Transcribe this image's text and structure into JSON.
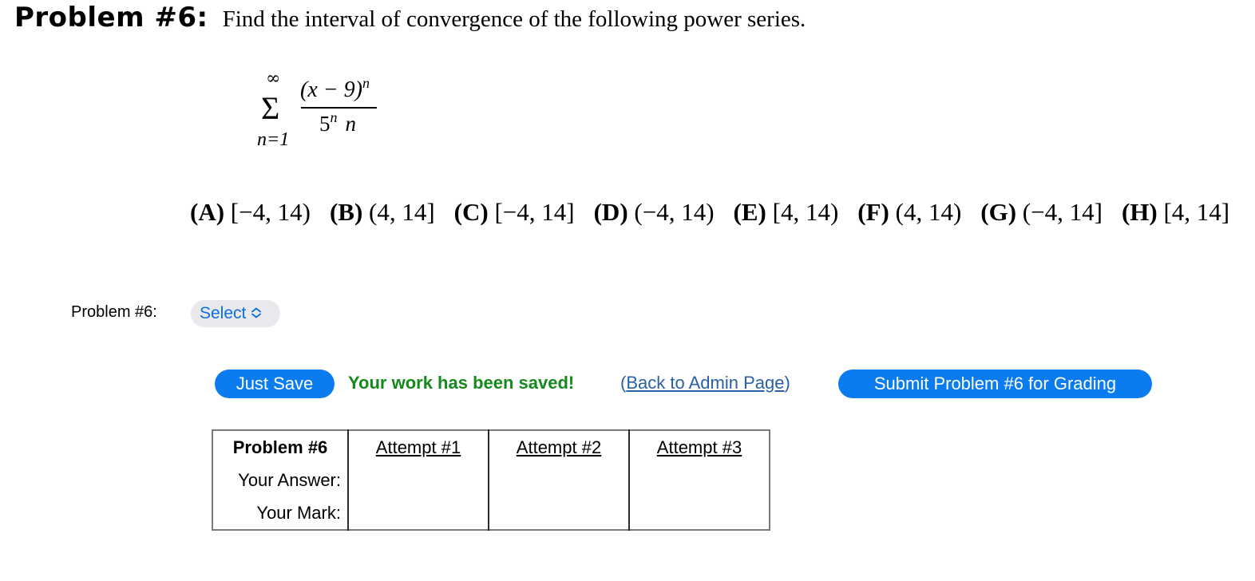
{
  "header": {
    "title": "Problem #6:",
    "instruction": "Find the interval of convergence of the following power series."
  },
  "formula": {
    "sum_upper": "∞",
    "sum_symbol": "Σ",
    "sum_lower": "n=1",
    "numerator_base": "(x − 9)",
    "numerator_exp": "n",
    "denominator_base": "5",
    "denominator_exp": "n",
    "denominator_tail": "n"
  },
  "choices": [
    {
      "letter": "(A)",
      "interval": "[−4, 14)"
    },
    {
      "letter": "(B)",
      "interval": "(4, 14]"
    },
    {
      "letter": "(C)",
      "interval": "[−4, 14]"
    },
    {
      "letter": "(D)",
      "interval": "(−4, 14)"
    },
    {
      "letter": "(E)",
      "interval": "[4, 14)"
    },
    {
      "letter": "(F)",
      "interval": "(4, 14)"
    },
    {
      "letter": "(G)",
      "interval": "(−4, 14]"
    },
    {
      "letter": "(H)",
      "interval": "[4, 14]"
    }
  ],
  "answer": {
    "label": "Problem #6:",
    "select_value": "Select",
    "chevron_icon": "up-down-chevron-icon"
  },
  "actions": {
    "save_label": "Just Save",
    "saved_message": "Your work has been saved!",
    "admin_link_open": "(",
    "admin_link_text": "Back to Admin Page",
    "admin_link_close": ")",
    "submit_label": "Submit Problem #6 for Grading"
  },
  "attempts_table": {
    "header_label": "Problem #6",
    "attempts": [
      "Attempt #1",
      "Attempt #2",
      "Attempt #3"
    ],
    "row_answer_label": "Your Answer:",
    "row_mark_label": "Your Mark:",
    "answers": [
      "",
      "",
      ""
    ],
    "marks": [
      "",
      "",
      ""
    ]
  },
  "colors": {
    "button_blue": "#0a7cf0",
    "select_text_blue": "#0a6fe0",
    "select_bg": "#e8e8ed",
    "saved_green": "#14891c",
    "link_blue": "#2a60a8"
  }
}
